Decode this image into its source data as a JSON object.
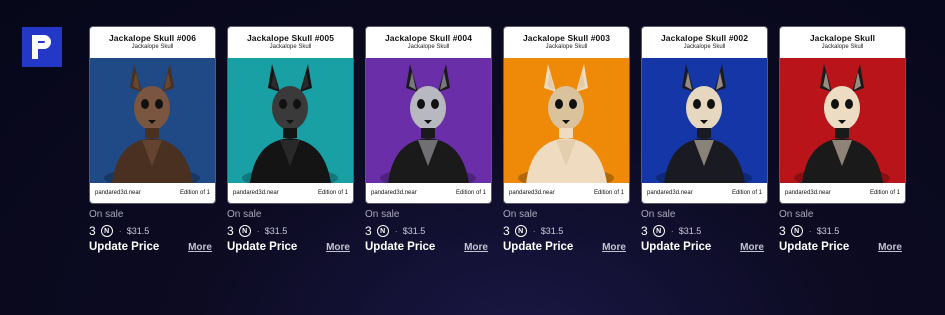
{
  "brand": {
    "logo_icon": "paras-logo-icon",
    "logo_color": "#2438c8"
  },
  "items": [
    {
      "title": "Jackalope Skull #006",
      "collection": "Jackalope Skull",
      "creator": "pandared3d.near",
      "edition": "Edition of 1",
      "status": "On sale",
      "price": "3",
      "currency_icon": "near-icon",
      "usd": "$31.5",
      "update_label": "Update Price",
      "more_label": "More",
      "bg": "#1f4a86",
      "figure": "#4a3020",
      "accent": "#7a5640"
    },
    {
      "title": "Jackalope Skull #005",
      "collection": "Jackalope Skull",
      "creator": "pandared3d.near",
      "edition": "Edition of 1",
      "status": "On sale",
      "price": "3",
      "currency_icon": "near-icon",
      "usd": "$31.5",
      "update_label": "Update Price",
      "more_label": "More",
      "bg": "#19a0a4",
      "figure": "#141414",
      "accent": "#3a3a3a"
    },
    {
      "title": "Jackalope Skull #004",
      "collection": "Jackalope Skull",
      "creator": "pandared3d.near",
      "edition": "Edition of 1",
      "status": "On sale",
      "price": "3",
      "currency_icon": "near-icon",
      "usd": "$31.5",
      "update_label": "Update Price",
      "more_label": "More",
      "bg": "#6a2ea8",
      "figure": "#1a1a1a",
      "accent": "#b8b8c0"
    },
    {
      "title": "Jackalope Skull #003",
      "collection": "Jackalope Skull",
      "creator": "pandared3d.near",
      "edition": "Edition of 1",
      "status": "On sale",
      "price": "3",
      "currency_icon": "near-icon",
      "usd": "$31.5",
      "update_label": "Update Price",
      "more_label": "More",
      "bg": "#ee8a08",
      "figure": "#efdcc0",
      "accent": "#d9c29c"
    },
    {
      "title": "Jackalope Skull #002",
      "collection": "Jackalope Skull",
      "creator": "pandared3d.near",
      "edition": "Edition of 1",
      "status": "On sale",
      "price": "3",
      "currency_icon": "near-icon",
      "usd": "$31.5",
      "update_label": "Update Price",
      "more_label": "More",
      "bg": "#1536a6",
      "figure": "#1a1a22",
      "accent": "#e6d8c0"
    },
    {
      "title": "Jackalope Skull",
      "collection": "Jackalope Skull",
      "creator": "pandared3d.near",
      "edition": "Edition of 1",
      "status": "On sale",
      "price": "3",
      "currency_icon": "near-icon",
      "usd": "$31.5",
      "update_label": "Update Price",
      "more_label": "More",
      "bg": "#b8141a",
      "figure": "#1a1a1a",
      "accent": "#ecdcc4"
    }
  ]
}
